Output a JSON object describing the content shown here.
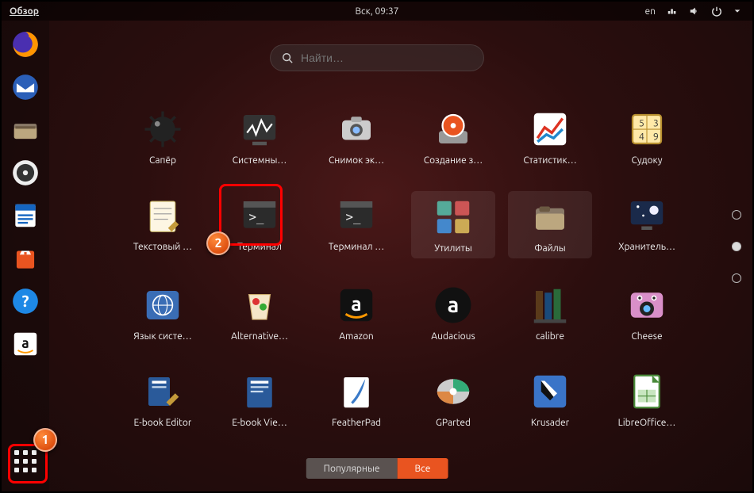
{
  "topbar": {
    "activities": "Обзор",
    "clock": "Вск, 09:37",
    "lang": "en"
  },
  "search": {
    "placeholder": "Найти…"
  },
  "dock": [
    {
      "name": "firefox"
    },
    {
      "name": "thunderbird"
    },
    {
      "name": "files"
    },
    {
      "name": "rhythmbox"
    },
    {
      "name": "writer"
    },
    {
      "name": "software"
    },
    {
      "name": "help"
    },
    {
      "name": "amazon"
    }
  ],
  "apps": [
    {
      "name": "saper",
      "label": "Сапёр"
    },
    {
      "name": "system-monitor",
      "label": "Системны…"
    },
    {
      "name": "screenshot",
      "label": "Снимок эк…"
    },
    {
      "name": "startup-disk",
      "label": "Создание з…"
    },
    {
      "name": "statistics",
      "label": "Статистик…"
    },
    {
      "name": "sudoku",
      "label": "Судоку"
    },
    {
      "name": "text-editor",
      "label": "Текстовый …"
    },
    {
      "name": "terminal",
      "label": "Терминал"
    },
    {
      "name": "terminal-alt",
      "label": "Терминал …"
    },
    {
      "name": "utilities",
      "label": "Утилиты",
      "folder": true
    },
    {
      "name": "files-app",
      "label": "Файлы",
      "folder": true
    },
    {
      "name": "screensaver",
      "label": "Хранитель…"
    },
    {
      "name": "language",
      "label": "Язык систе…"
    },
    {
      "name": "alternative",
      "label": "Alternative…"
    },
    {
      "name": "amazon",
      "label": "Amazon"
    },
    {
      "name": "audacious",
      "label": "Audacious"
    },
    {
      "name": "calibre",
      "label": "calibre"
    },
    {
      "name": "cheese",
      "label": "Cheese"
    },
    {
      "name": "ebook-editor",
      "label": "E-book Editor"
    },
    {
      "name": "ebook-viewer",
      "label": "E-book Vie…"
    },
    {
      "name": "featherpad",
      "label": "FeatherPad"
    },
    {
      "name": "gparted",
      "label": "GParted"
    },
    {
      "name": "krusader",
      "label": "Krusader"
    },
    {
      "name": "libreoffice",
      "label": "LibreOffice…"
    }
  ],
  "tabs": {
    "inactive": "Популярные",
    "active": "Все"
  },
  "annotations": {
    "one": "1",
    "two": "2"
  }
}
